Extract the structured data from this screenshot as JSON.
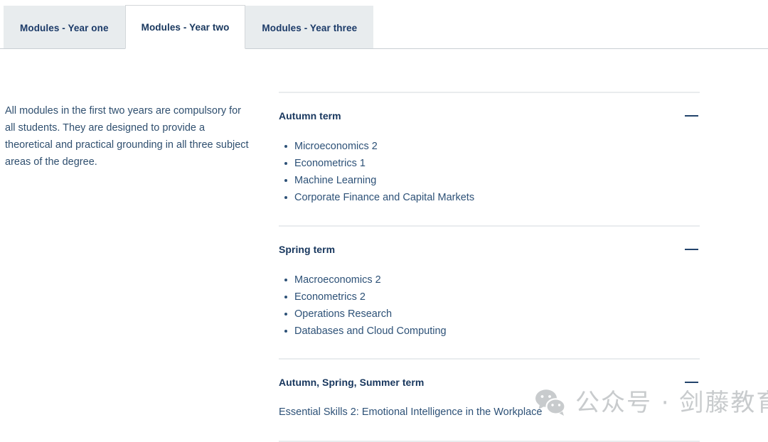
{
  "tabs": [
    {
      "label": "Modules - Year one",
      "active": false
    },
    {
      "label": "Modules - Year two",
      "active": true
    },
    {
      "label": "Modules - Year three",
      "active": false
    }
  ],
  "intro": {
    "text": "All modules in the first two years are compulsory for all students. They are designed to provide a theoretical and practical grounding in all three subject areas of the degree."
  },
  "accordion": {
    "collapse_icon": "minus-icon",
    "sections": [
      {
        "title": "Autumn term",
        "type": "list",
        "items": [
          "Microeconomics 2",
          "Econometrics 1",
          "Machine Learning",
          "Corporate Finance and Capital Markets"
        ]
      },
      {
        "title": "Spring term",
        "type": "list",
        "items": [
          "Macroeconomics 2",
          "Econometrics 2",
          "Operations Research",
          "Databases and Cloud Computing"
        ]
      },
      {
        "title": "Autumn, Spring, Summer term",
        "type": "text",
        "text": "Essential Skills 2: Emotional Intelligence in the Workplace"
      }
    ]
  },
  "watermark": {
    "icon": "wechat-icon",
    "text": "公众号 · 剑藤教育"
  },
  "colors": {
    "tab_inactive_bg": "#e8ecee",
    "tab_active_bg": "#ffffff",
    "heading": "#17365d",
    "body": "#2d5177",
    "divider": "#e9ecee",
    "watermark": "#c8cbcd"
  }
}
